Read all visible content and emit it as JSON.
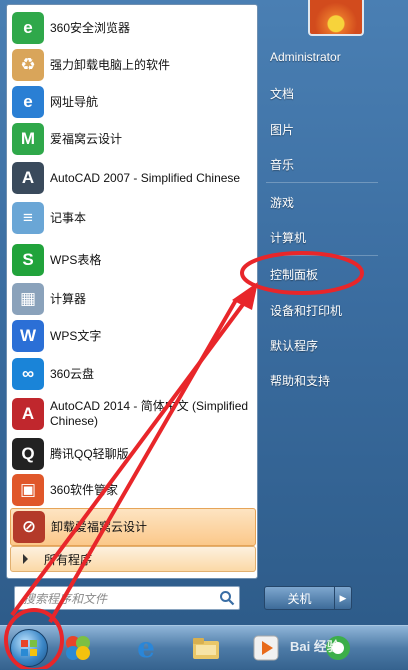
{
  "start_menu": {
    "programs": [
      {
        "label": "360安全浏览器",
        "icon": "360-browser-icon",
        "color": "#2fa84a",
        "glyph": "e"
      },
      {
        "label": "强力卸载电脑上的软件",
        "icon": "uninstaller-box-icon",
        "color": "#d9a55a",
        "glyph": "♻"
      },
      {
        "label": "网址导航",
        "icon": "ie-navigation-icon",
        "color": "#2a7fd4",
        "glyph": "e"
      },
      {
        "label": "爱福窝云设计",
        "icon": "aifuwo-icon",
        "color": "#2fa84a",
        "glyph": "M"
      },
      {
        "label": "AutoCAD 2007 - Simplified Chinese",
        "icon": "autocad-2007-icon",
        "color": "#3a4a5c",
        "glyph": "A"
      },
      {
        "label": "记事本",
        "icon": "notepad-icon",
        "color": "#6aa6d6",
        "glyph": "≡"
      },
      {
        "label": "WPS表格",
        "icon": "wps-spreadsheet-icon",
        "color": "#21a33b",
        "glyph": "S"
      },
      {
        "label": "计算器",
        "icon": "calculator-icon",
        "color": "#8aa2bb",
        "glyph": "▦"
      },
      {
        "label": "WPS文字",
        "icon": "wps-writer-icon",
        "color": "#2b6fd6",
        "glyph": "W"
      },
      {
        "label": "360云盘",
        "icon": "360-cloud-icon",
        "color": "#1a84d8",
        "glyph": "∞"
      },
      {
        "label": "AutoCAD 2014 - 简体中文 (Simplified Chinese)",
        "icon": "autocad-2014-icon",
        "color": "#c0272d",
        "glyph": "A"
      },
      {
        "label": "腾讯QQ轻聊版",
        "icon": "qq-penguin-icon",
        "color": "#222222",
        "glyph": "Q"
      },
      {
        "label": "360软件管家",
        "icon": "360-software-manager-icon",
        "color": "#e0572a",
        "glyph": "▣"
      },
      {
        "label": "卸载爱福窝云设计",
        "icon": "uninstall-aifuwo-icon",
        "color": "#b43a2a",
        "glyph": "⊘"
      }
    ],
    "all_programs": "所有程序",
    "search_placeholder": "搜索程序和文件",
    "right": {
      "user": "Administrator",
      "items": [
        "文档",
        "图片",
        "音乐",
        "游戏",
        "计算机",
        "控制面板",
        "设备和打印机",
        "默认程序",
        "帮助和支持"
      ]
    },
    "shutdown": "关机"
  },
  "taskbar": {
    "items": [
      "start-orb-icon",
      "windows-logo-icon",
      "ie-taskbar-icon",
      "explorer-folder-icon",
      "media-player-icon",
      "360-taskbar-icon"
    ]
  },
  "watermark": "Bai 经验",
  "colors": {
    "annotation": "#e8262a",
    "highlight": "#fbc88a"
  }
}
